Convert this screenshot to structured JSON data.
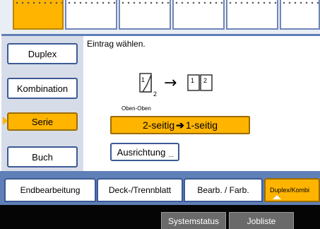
{
  "side_menu": [
    {
      "label": "Duplex"
    },
    {
      "label": "Kombination"
    },
    {
      "label": "Serie"
    },
    {
      "label": "Buch"
    }
  ],
  "prompt": "Eintrag wählen.",
  "diagram": {
    "left_page": "1",
    "subscript": "2",
    "arrow": "→",
    "right_pages": [
      "1",
      "2"
    ]
  },
  "orientation_label": "Oben-Oben",
  "mode": {
    "before": "2-seitig",
    "arrow": "➔",
    "after": "1-seitig"
  },
  "orientation_button": {
    "label": "Ausrichtung",
    "ellipsis": "..."
  },
  "bottom_tabs": [
    {
      "label": "Endbearbeitung"
    },
    {
      "label": "Deck-/Trennblatt"
    },
    {
      "label": "Bearb. / Farb."
    },
    {
      "label": "Duplex/Kombi"
    }
  ],
  "status_buttons": [
    {
      "label": "Systemstatus"
    },
    {
      "label": "Jobliste"
    }
  ],
  "colors": {
    "accent": "#ffb400",
    "frame": "#3c5a96",
    "panel_bg": "#d7dde8"
  }
}
